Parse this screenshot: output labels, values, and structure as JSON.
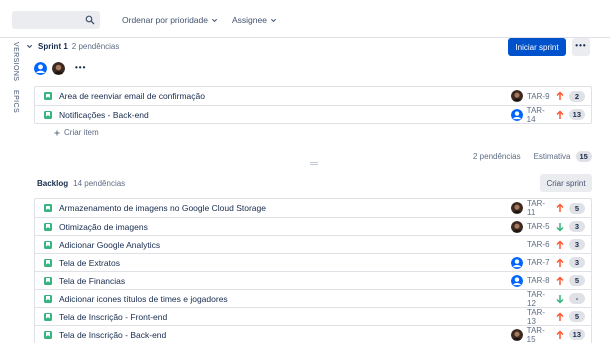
{
  "toolbar": {
    "search_placeholder": "",
    "filters": [
      "Ordenar por prioridade",
      "Assignee"
    ]
  },
  "side_tabs": [
    "VERSIONS",
    "EPICS"
  ],
  "sprint": {
    "title": "Sprint 1",
    "count": "2 pendências",
    "start_button": "Iniciar sprint",
    "more_label": "•••",
    "issues": [
      {
        "summary": "Area de reenviar email de confirmação",
        "key": "TAR-9",
        "priority": "high",
        "points": "2",
        "avatar": "photo"
      },
      {
        "summary": "Notificações - Back-end",
        "key": "TAR-14",
        "priority": "high",
        "points": "13",
        "avatar": "default"
      }
    ],
    "create_label": "Criar item",
    "footer_count": "2 pendências",
    "estimate_label": "Estimativa",
    "estimate_value": "15"
  },
  "backlog": {
    "title": "Backlog",
    "count": "14 pendências",
    "create_sprint_button": "Criar sprint",
    "issues": [
      {
        "summary": "Armazenamento de imagens no Google Cloud Storage",
        "key": "TAR-11",
        "priority": "high",
        "points": "5",
        "avatar": "photo"
      },
      {
        "summary": "Otimização de imagens",
        "key": "TAR-5",
        "priority": "low",
        "points": "3",
        "avatar": "photo"
      },
      {
        "summary": "Adicionar Google Analytics",
        "key": "TAR-6",
        "priority": "high",
        "points": "3",
        "avatar": "none"
      },
      {
        "summary": "Tela de Extratos",
        "key": "TAR-7",
        "priority": "high",
        "points": "3",
        "avatar": "default"
      },
      {
        "summary": "Tela de Financias",
        "key": "TAR-8",
        "priority": "high",
        "points": "5",
        "avatar": "default"
      },
      {
        "summary": "Adicionar icones títulos de times e jogadores",
        "key": "TAR-12",
        "priority": "low",
        "points": "-",
        "avatar": "none"
      },
      {
        "summary": "Tela de Inscrição - Front-end",
        "key": "TAR-13",
        "priority": "high",
        "points": "5",
        "avatar": "none"
      },
      {
        "summary": "Tela de Inscrição - Back-end",
        "key": "TAR-15",
        "priority": "high",
        "points": "13",
        "avatar": "photo"
      }
    ]
  },
  "colors": {
    "primary": "#0052cc",
    "story": "#36b37e",
    "priority_high": "#ff5630",
    "priority_low": "#36b37e"
  }
}
